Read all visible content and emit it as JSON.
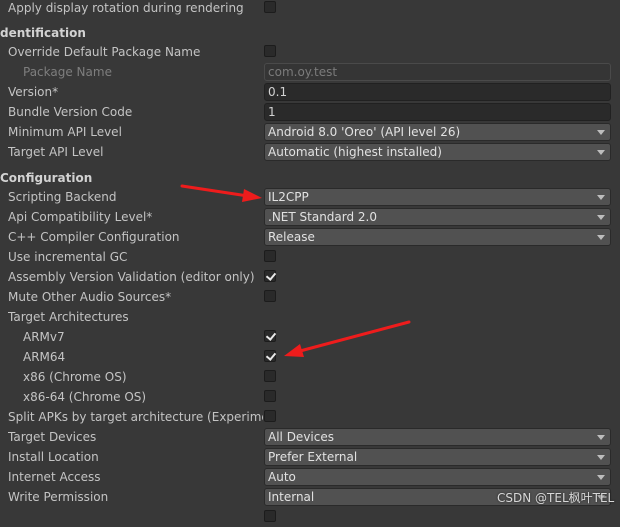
{
  "rows": {
    "apply_rotation": {
      "label": "Apply display rotation during rendering",
      "checked": false
    },
    "identification_header": "dentification",
    "override_package": {
      "label": "Override Default Package Name",
      "checked": false
    },
    "package_name": {
      "label": "Package Name",
      "value": "com.oy.test"
    },
    "version": {
      "label": "Version*",
      "value": "0.1"
    },
    "bundle_code": {
      "label": "Bundle Version Code",
      "value": "1"
    },
    "min_api": {
      "label": "Minimum API Level",
      "value": "Android 8.0 'Oreo' (API level 26)"
    },
    "target_api": {
      "label": "Target API Level",
      "value": "Automatic (highest installed)"
    },
    "configuration_header": "Configuration",
    "scripting_backend": {
      "label": "Scripting Backend",
      "value": "IL2CPP"
    },
    "api_compat": {
      "label": "Api Compatibility Level*",
      "value": ".NET Standard 2.0"
    },
    "cpp_compiler": {
      "label": "C++ Compiler Configuration",
      "value": "Release"
    },
    "incremental_gc": {
      "label": "Use incremental GC",
      "checked": false
    },
    "assembly_validation": {
      "label": "Assembly Version Validation (editor only)",
      "checked": true
    },
    "mute_audio": {
      "label": "Mute Other Audio Sources*",
      "checked": false
    },
    "target_arch": {
      "label": "Target Architectures"
    },
    "armv7": {
      "label": "ARMv7",
      "checked": true
    },
    "arm64": {
      "label": "ARM64",
      "checked": true
    },
    "x86": {
      "label": "x86 (Chrome OS)",
      "checked": false
    },
    "x86_64": {
      "label": "x86-64 (Chrome OS)",
      "checked": false
    },
    "split_apks": {
      "label": "Split APKs by target architecture (Experimental)",
      "checked": false
    },
    "target_devices": {
      "label": "Target Devices",
      "value": "All Devices"
    },
    "install_location": {
      "label": "Install Location",
      "value": "Prefer External"
    },
    "internet_access": {
      "label": "Internet Access",
      "value": "Auto"
    },
    "write_permission": {
      "label": "Write Permission",
      "value": "Internal"
    }
  },
  "watermark": "CSDN @TEL枫叶TEL",
  "colors": {
    "background": "#383838",
    "annotation_arrow": "#ee1c1c"
  }
}
